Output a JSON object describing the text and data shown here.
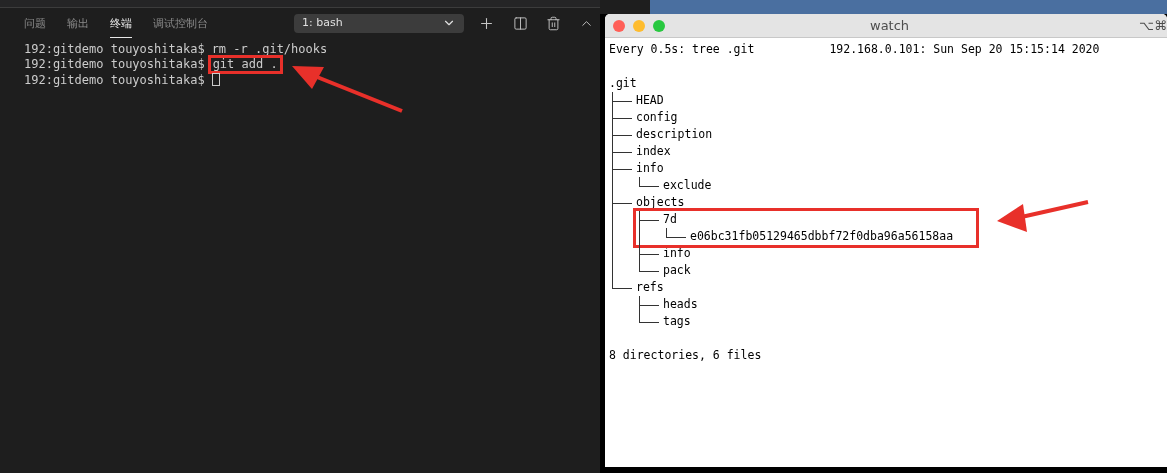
{
  "panel_tabs": [
    {
      "label": "问题",
      "selected": false
    },
    {
      "label": "输出",
      "selected": false
    },
    {
      "label": "终端",
      "selected": true
    },
    {
      "label": "调试控制台",
      "selected": false
    }
  ],
  "terminal_select": {
    "value": "1: bash"
  },
  "terminal_lines": [
    {
      "prompt": "192:gitdemo touyoshitaka$",
      "command": "rm -r .git/hooks",
      "highlighted": false,
      "cursor": false
    },
    {
      "prompt": "192:gitdemo touyoshitaka$",
      "command": "git add .",
      "highlighted": true,
      "cursor": false
    },
    {
      "prompt": "192:gitdemo touyoshitaka$",
      "highlighted": false,
      "cursor": true
    }
  ],
  "watch_window": {
    "title": "watch",
    "shortcut": "⌥⌘",
    "header_left": "Every 0.5s: tree .git",
    "header_right": "192.168.0.101: Sun Sep 20 15:15:14 2020",
    "tree": {
      "name": ".git",
      "children": [
        {
          "name": "HEAD"
        },
        {
          "name": "config"
        },
        {
          "name": "description"
        },
        {
          "name": "index"
        },
        {
          "name": "info",
          "children": [
            {
              "name": "exclude"
            }
          ]
        },
        {
          "name": "objects",
          "children": [
            {
              "name": "7d",
              "highlighted": true,
              "children": [
                {
                  "name": "e06bc31fb05129465dbbf72f0dba96a56158aa"
                }
              ]
            },
            {
              "name": "info"
            },
            {
              "name": "pack"
            }
          ]
        },
        {
          "name": "refs",
          "children": [
            {
              "name": "heads"
            },
            {
              "name": "tags"
            }
          ]
        }
      ]
    },
    "summary": "8 directories, 6 files"
  }
}
